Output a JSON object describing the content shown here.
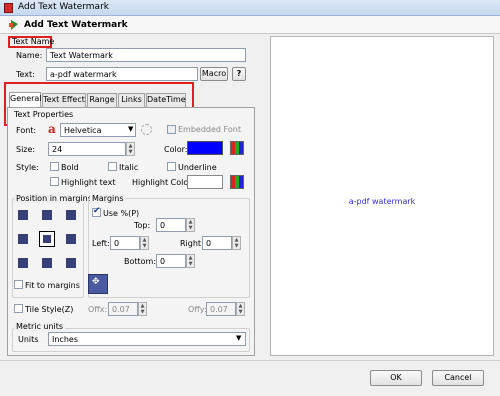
{
  "window": {
    "title": "Add Text Watermark"
  },
  "header": {
    "title": "Add Text Watermark"
  },
  "text_name": {
    "section_label": "Text Name",
    "name_label": "Name:",
    "name_value": "Text Watermark",
    "text_label": "Text:",
    "text_value": "a-pdf watermark",
    "macro_label": "Macro",
    "help_label": "?"
  },
  "tabs": [
    "General",
    "Text Effect",
    "Range",
    "Links",
    "DateTime"
  ],
  "text_properties": {
    "title": "Text Properties",
    "font_label": "Font:",
    "font_value": "Helvetica",
    "embedded_font_label": "Embedded Font",
    "size_label": "Size:",
    "size_value": "24",
    "color_label": "Color:",
    "color_value": "#0000ff",
    "style_label": "Style:",
    "bold_label": "Bold",
    "italic_label": "Italic",
    "underline_label": "Underline",
    "highlight_text_label": "Highlight text",
    "highlight_color_label": "Highlight Color:"
  },
  "position": {
    "title": "Position in margins"
  },
  "margins": {
    "title": "Margins",
    "use_percent_label": "Use %(P)",
    "top_label": "Top:",
    "top_value": "0",
    "left_label": "Left:",
    "left_value": "0",
    "right_label": "Right:",
    "right_value": "0",
    "bottom_label": "Bottom:",
    "bottom_value": "0"
  },
  "fit": {
    "fit_label": "Fit to margins"
  },
  "tile": {
    "tile_label": "Tile Style(Z)",
    "offx1_label": "Offx:",
    "offx1_value": "0.07",
    "offy_label": "Offy:",
    "offy_value": "0.07"
  },
  "metric": {
    "title": "Metric units",
    "units_label": "Units",
    "units_value": "Inches"
  },
  "preview": {
    "text": "a-pdf watermark"
  },
  "footer": {
    "ok_label": "OK",
    "cancel_label": "Cancel"
  }
}
